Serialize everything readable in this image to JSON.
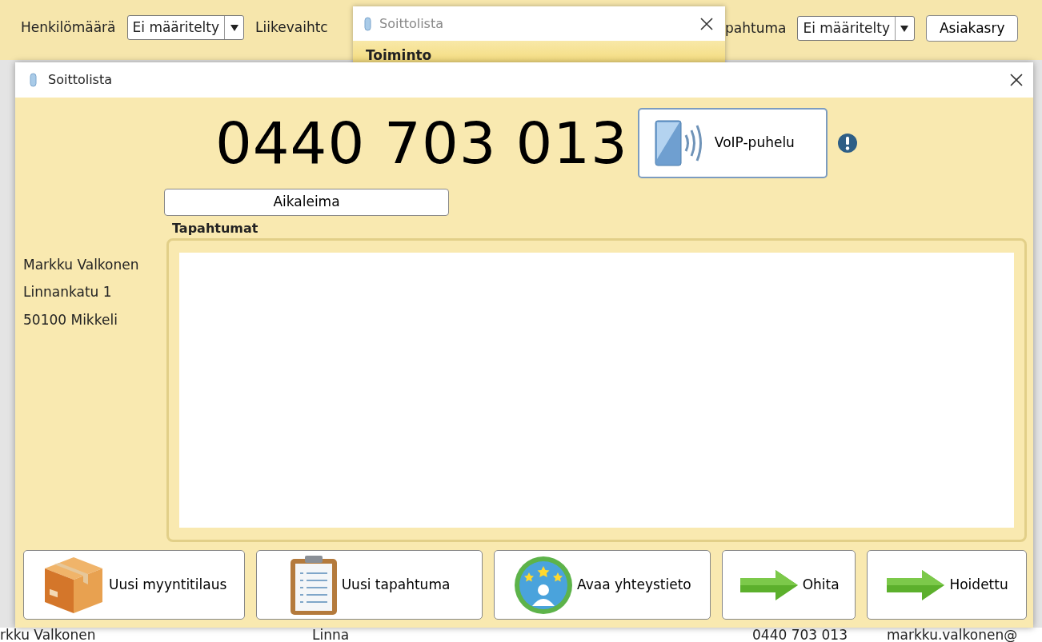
{
  "filter_bar": {
    "left": [
      {
        "kind": "label",
        "text": "Henkilömäärä"
      },
      {
        "kind": "select",
        "text": "Ei määritelty"
      },
      {
        "kind": "label",
        "text": "Liikevaihtc"
      }
    ],
    "right": [
      {
        "kind": "label",
        "text": "pahtuma"
      },
      {
        "kind": "select",
        "text": "Ei määritelty"
      },
      {
        "kind": "button",
        "text": "Asiakasry"
      }
    ]
  },
  "back_dialog": {
    "title": "Soittolista",
    "header": "Toiminto"
  },
  "bottom_row": {
    "cells": [
      "rkku Valkonen",
      "Linna",
      "0440 703 013",
      "markku.valkonen@"
    ]
  },
  "dialog": {
    "title": "Soittolista",
    "phone": "0440 703 013",
    "voip_button": "VoIP-puhelu",
    "timestamp_button": "Aikaleima",
    "events_label": "Tapahtumat",
    "contact": [
      "Markku Valkonen",
      "Linnankatu 1",
      "50100 Mikkeli"
    ],
    "actions": [
      {
        "kind": "box",
        "label": "Uusi myyntitilaus"
      },
      {
        "kind": "clipboard",
        "label": "Uusi tapahtuma"
      },
      {
        "kind": "contact",
        "label": "Avaa yhteystieto"
      },
      {
        "kind": "arrow",
        "label": "Ohita"
      },
      {
        "kind": "arrow",
        "label": "Hoidettu"
      }
    ]
  }
}
